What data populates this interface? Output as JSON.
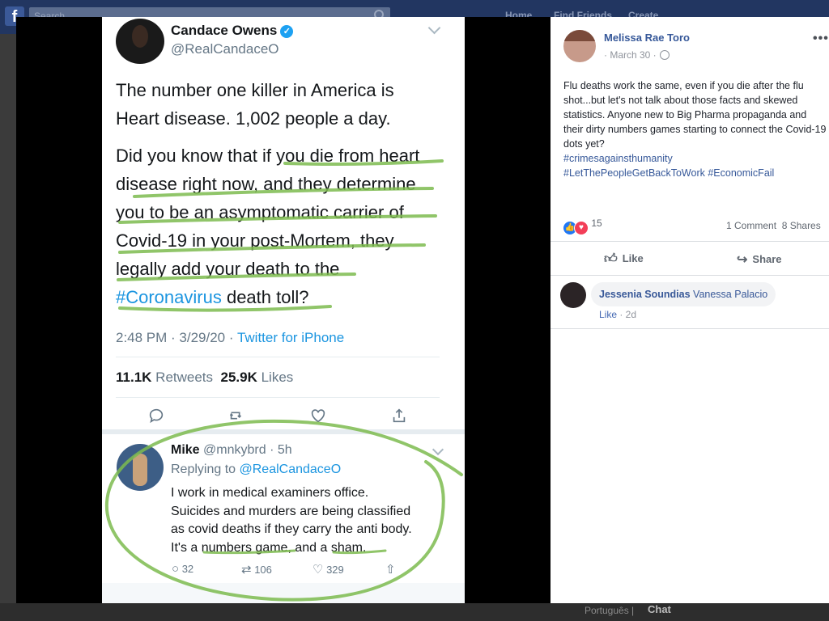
{
  "background": {
    "search_placeholder": "Search",
    "nav": [
      "Home",
      "Find Friends",
      "Create"
    ],
    "footer_lang": "Português |",
    "chat_label": "Chat"
  },
  "tweet": {
    "author": "Candace Owens",
    "handle": "@RealCandaceO",
    "paragraph1": [
      "The number one killer in America is",
      "Heart disease. 1,002 people a day."
    ],
    "paragraph2": [
      "Did you know that if you die from heart",
      "disease right now, and they determine",
      "you to be an asymptomatic carrier of",
      "Covid-19 in your post-Mortem, they",
      "legally add your death to the"
    ],
    "hashtag": "#Coronavirus",
    "last_line_rest": " death toll?",
    "time": "2:48 PM · 3/29/20 · ",
    "source": "Twitter for iPhone",
    "retweets_count": "11.1K",
    "retweets_label": " Retweets",
    "likes_count": "25.9K",
    "likes_label": " Likes"
  },
  "reply": {
    "name": "Mike",
    "handle": " @mnkybrd · 5h",
    "replying_prefix": "Replying to ",
    "replying_handle": "@RealCandaceO",
    "lines": [
      "I work in medical examiners office.",
      "Suicides and murders are being classified",
      "as covid deaths if they carry the anti body.",
      "It's a numbers game, and a sham."
    ],
    "replies": "32",
    "retweets": "106",
    "likes": "329"
  },
  "post": {
    "author": "Melissa Rae Toro",
    "date": "· March 30 ·",
    "more": "•••",
    "body": "Flu deaths work the same, even if you die after the flu shot...but let's not talk about those facts and skewed statistics. Anyone new to Big Pharma propaganda and their dirty numbers games starting to connect the Covid-19 dots yet?",
    "tag1": "#crimesagainsthumanity",
    "tag2": "#LetThePeopleGetBackToWork",
    "tag3": " #EconomicFail",
    "reaction_count": "15",
    "comments": "1 Comment",
    "shares": "8 Shares",
    "like_label": "Like",
    "share_label": "Share"
  },
  "comment": {
    "author": "Jessenia Soundias",
    "mention": " Vanessa Palacio",
    "like_label": "Like",
    "age": " · 2d"
  },
  "colors": {
    "highlighter_green": "#7dbb4f",
    "twitter_blue": "#1b95e0",
    "facebook_link": "#365899"
  }
}
